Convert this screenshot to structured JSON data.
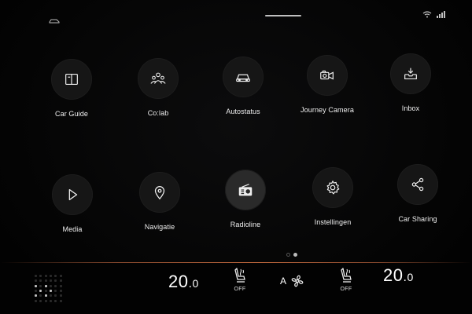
{
  "apps": [
    {
      "label": "Car Guide",
      "icon": "book-icon"
    },
    {
      "label": "Co:lab",
      "icon": "group-icon"
    },
    {
      "label": "Autostatus",
      "icon": "car-icon"
    },
    {
      "label": "Journey Camera",
      "icon": "camera-icon"
    },
    {
      "label": "Inbox",
      "icon": "inbox-icon"
    },
    {
      "label": "Media",
      "icon": "play-icon"
    },
    {
      "label": "Navigatie",
      "icon": "location-pin-icon"
    },
    {
      "label": "Radioline",
      "icon": "radio-icon"
    },
    {
      "label": "Instellingen",
      "icon": "gear-icon"
    },
    {
      "label": "Car Sharing",
      "icon": "share-icon"
    }
  ],
  "pagination": {
    "pages": 2,
    "active": 1
  },
  "climate": {
    "left_temp": {
      "whole": "20",
      "decimal": "0"
    },
    "right_temp": {
      "whole": "20",
      "decimal": "0"
    },
    "left_seat_heat": "OFF",
    "right_seat_heat": "OFF",
    "fan_mode": "A"
  },
  "colors": {
    "accent_line": "#c46a3e",
    "tile_bg": "#161616",
    "text": "#f0f0f0"
  }
}
